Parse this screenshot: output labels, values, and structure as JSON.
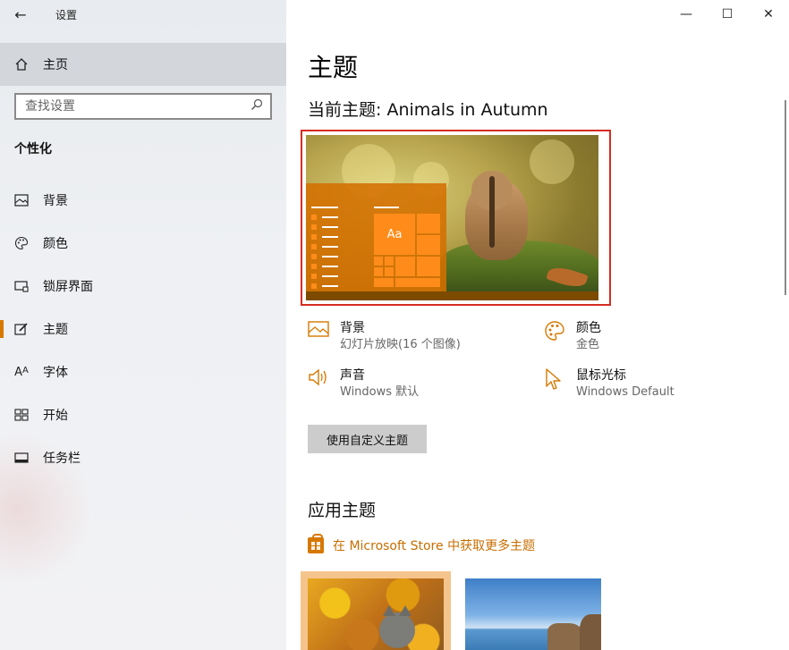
{
  "window": {
    "title": "设置",
    "controls": {
      "minimize": "—",
      "maximize": "☐",
      "close": "✕"
    }
  },
  "sidebar": {
    "back_icon": "arrow-left-icon",
    "home_label": "主页",
    "search_placeholder": "查找设置",
    "section_title": "个性化",
    "items": [
      {
        "label": "背景",
        "icon": "picture-icon",
        "active": false
      },
      {
        "label": "颜色",
        "icon": "palette-icon",
        "active": false
      },
      {
        "label": "锁屏界面",
        "icon": "lock-screen-icon",
        "active": false
      },
      {
        "label": "主题",
        "icon": "theme-brush-icon",
        "active": true
      },
      {
        "label": "字体",
        "icon": "font-icon",
        "active": false
      },
      {
        "label": "开始",
        "icon": "start-grid-icon",
        "active": false
      },
      {
        "label": "任务栏",
        "icon": "taskbar-icon",
        "active": false
      }
    ]
  },
  "main": {
    "page_title": "主题",
    "current_theme": "当前主题: Animals in Autumn",
    "preview": {
      "sample_text": "Aa"
    },
    "properties": [
      {
        "id": "background",
        "title": "背景",
        "subtitle": "幻灯片放映(16 个图像)",
        "icon": "picture-icon"
      },
      {
        "id": "color",
        "title": "颜色",
        "subtitle": "金色",
        "icon": "palette-icon"
      },
      {
        "id": "sound",
        "title": "声音",
        "subtitle": "Windows 默认",
        "icon": "speaker-icon"
      },
      {
        "id": "cursor",
        "title": "鼠标光标",
        "subtitle": "Windows Default",
        "icon": "cursor-icon"
      }
    ],
    "custom_button": "使用自定义主题",
    "apply_title": "应用主题",
    "store_link": "在 Microsoft Store 中获取更多主题"
  },
  "colors": {
    "accent": "#d77800",
    "selection_border": "#d62c20",
    "sidebar_active_bg": "#d3d6da"
  }
}
